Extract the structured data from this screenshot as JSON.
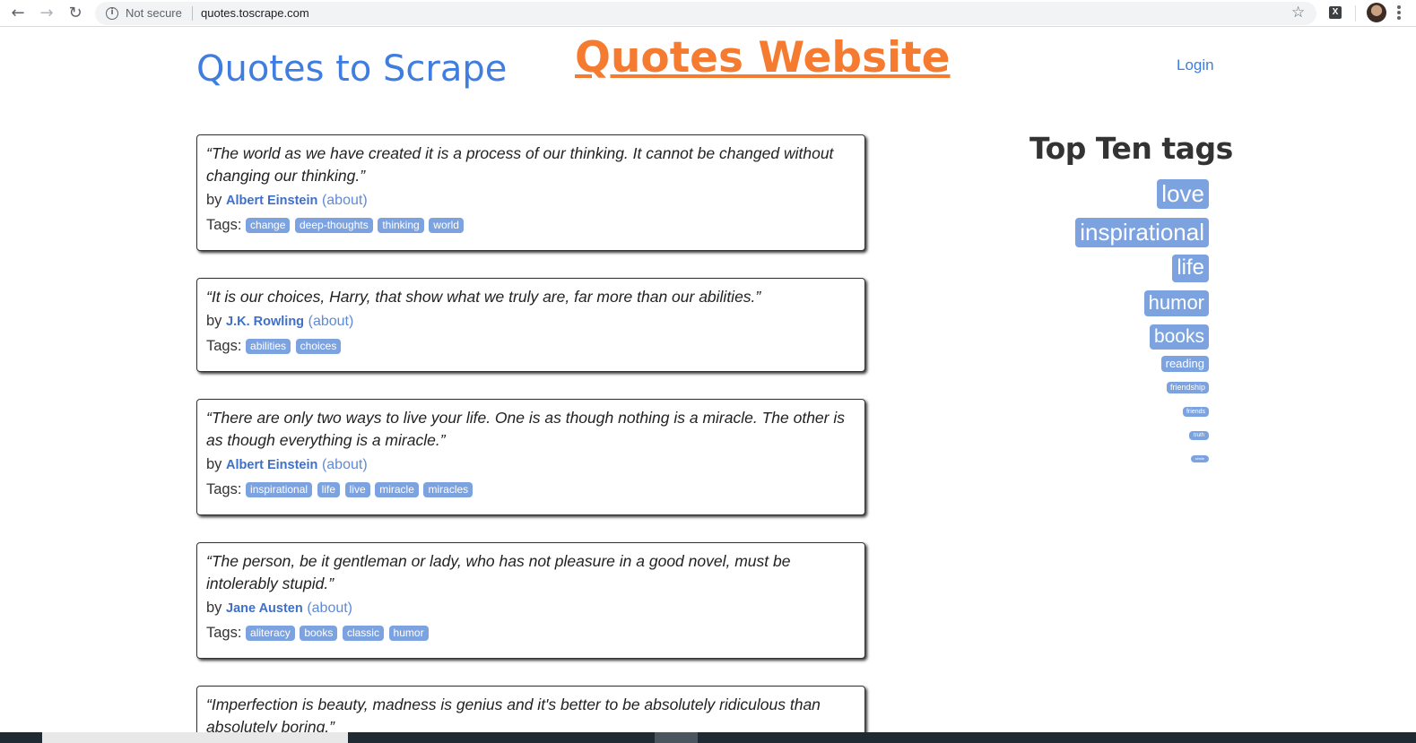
{
  "browser": {
    "security_label": "Not secure",
    "url": "quotes.toscrape.com",
    "info_icon": "i",
    "extension_icon": "X"
  },
  "site": {
    "title": "Quotes to Scrape",
    "overlay_title": "Quotes Website",
    "login_label": "Login"
  },
  "quotes": [
    {
      "text": "“The world as we have created it is a process of our thinking. It cannot be changed without changing our thinking.”",
      "by": "by",
      "author": "Albert Einstein",
      "about": "(about)",
      "tags_label": "Tags:",
      "tags": [
        "change",
        "deep-thoughts",
        "thinking",
        "world"
      ]
    },
    {
      "text": "“It is our choices, Harry, that show what we truly are, far more than our abilities.”",
      "by": "by",
      "author": "J.K. Rowling",
      "about": "(about)",
      "tags_label": "Tags:",
      "tags": [
        "abilities",
        "choices"
      ]
    },
    {
      "text": "“There are only two ways to live your life. One is as though nothing is a miracle. The other is as though everything is a miracle.”",
      "by": "by",
      "author": "Albert Einstein",
      "about": "(about)",
      "tags_label": "Tags:",
      "tags": [
        "inspirational",
        "life",
        "live",
        "miracle",
        "miracles"
      ]
    },
    {
      "text": "“The person, be it gentleman or lady, who has not pleasure in a good novel, must be intolerably stupid.”",
      "by": "by",
      "author": "Jane Austen",
      "about": "(about)",
      "tags_label": "Tags:",
      "tags": [
        "aliteracy",
        "books",
        "classic",
        "humor"
      ]
    },
    {
      "text": "“Imperfection is beauty, madness is genius and it's better to be absolutely ridiculous than absolutely boring.”"
    }
  ],
  "top_tags": {
    "title": "Top Ten tags",
    "items": [
      "love",
      "inspirational",
      "life",
      "humor",
      "books",
      "reading",
      "friendship",
      "friends",
      "truth",
      "simile"
    ]
  }
}
